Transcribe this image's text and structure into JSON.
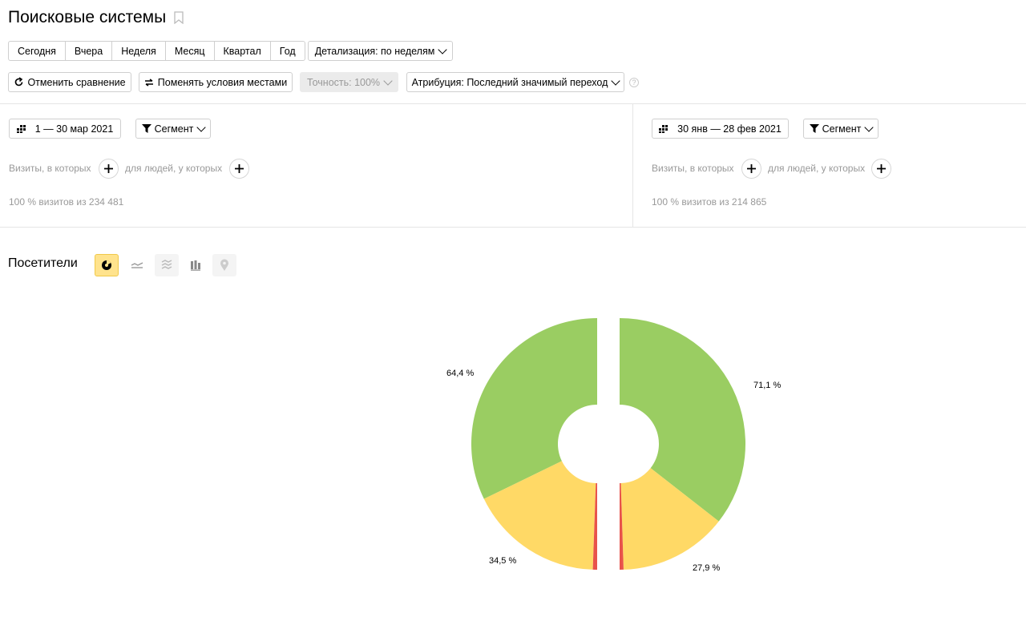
{
  "page": {
    "title": "Поисковые системы"
  },
  "toolbar": {
    "periods": [
      "Сегодня",
      "Вчера",
      "Неделя",
      "Месяц",
      "Квартал",
      "Год"
    ],
    "detail_label": "Детализация: по неделям",
    "cancel_compare_label": "Отменить сравнение",
    "swap_label": "Поменять условия местами",
    "accuracy_label": "Точность: 100%",
    "attribution_label": "Атрибуция: Последний значимый переход",
    "help_glyph": "?"
  },
  "left_panel": {
    "date_range": "1 — 30 мар 2021",
    "segment_label": "Сегмент",
    "visits_where": "Визиты, в которых",
    "people_where": "для людей, у которых",
    "summary": "100 % визитов из 234 481"
  },
  "right_panel": {
    "date_range": "30 янв — 28 фев 2021",
    "segment_label": "Сегмент",
    "visits_where": "Визиты, в которых",
    "people_where": "для людей, у которых",
    "summary": "100 % визитов из 214 865"
  },
  "report": {
    "section_title": "Посетители",
    "chart_views": [
      "pie-icon",
      "line-icon",
      "area-icon",
      "bar-icon",
      "map-icon"
    ],
    "active_view": "pie-icon"
  },
  "colors": {
    "green": "#9acd62",
    "yellow": "#ffd966",
    "red": "#e8534b",
    "accent": "#ffe38d"
  },
  "chart_data": {
    "type": "pie",
    "series": [
      {
        "period": "1 — 30 мар 2021",
        "slices": [
          {
            "value": 64.4,
            "color": "#9acd62",
            "label": "64,4 %"
          },
          {
            "value": 34.5,
            "color": "#ffd966",
            "label": "34,5 %"
          },
          {
            "value": 1.1,
            "color": "#e8534b",
            "label": ""
          }
        ]
      },
      {
        "period": "30 янв — 28 фев 2021",
        "slices": [
          {
            "value": 71.1,
            "color": "#9acd62",
            "label": "71,1 %"
          },
          {
            "value": 27.9,
            "color": "#ffd966",
            "label": "27,9 %"
          },
          {
            "value": 1.0,
            "color": "#e8534b",
            "label": ""
          }
        ]
      }
    ]
  }
}
